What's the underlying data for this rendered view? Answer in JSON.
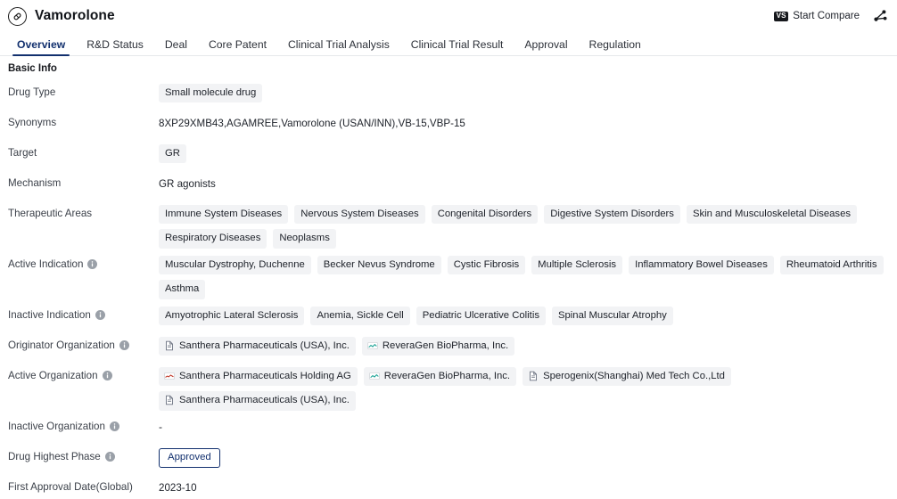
{
  "header": {
    "drug_name": "Vamorolone",
    "drug_icon": "capsule-icon",
    "compare_label": "Start Compare",
    "compare_badge": "VS",
    "share_icon": "share-nodes-icon"
  },
  "tabs": [
    {
      "label": "Overview",
      "active": true
    },
    {
      "label": "R&D Status",
      "active": false
    },
    {
      "label": "Deal",
      "active": false
    },
    {
      "label": "Core Patent",
      "active": false
    },
    {
      "label": "Clinical Trial Analysis",
      "active": false
    },
    {
      "label": "Clinical Trial Result",
      "active": false
    },
    {
      "label": "Approval",
      "active": false
    },
    {
      "label": "Regulation",
      "active": false
    }
  ],
  "section": {
    "title": "Basic Info"
  },
  "fields": {
    "drug_type": {
      "label": "Drug Type",
      "values": [
        "Small molecule drug"
      ]
    },
    "synonyms": {
      "label": "Synonyms",
      "text": "8XP29XMB43,AGAMREE,Vamorolone (USAN/INN),VB-15,VBP-15"
    },
    "target": {
      "label": "Target",
      "values": [
        "GR"
      ]
    },
    "mechanism": {
      "label": "Mechanism",
      "text": "GR agonists"
    },
    "therapeutic_areas": {
      "label": "Therapeutic Areas",
      "values": [
        "Immune System Diseases",
        "Nervous System Diseases",
        "Congenital Disorders",
        "Digestive System Disorders",
        "Skin and Musculoskeletal Diseases",
        "Respiratory Diseases",
        "Neoplasms"
      ]
    },
    "active_indication": {
      "label": "Active Indication",
      "has_info": true,
      "values": [
        "Muscular Dystrophy, Duchenne",
        "Becker Nevus Syndrome",
        "Cystic Fibrosis",
        "Multiple Sclerosis",
        "Inflammatory Bowel Diseases",
        "Rheumatoid Arthritis",
        "Asthma"
      ]
    },
    "inactive_indication": {
      "label": "Inactive Indication",
      "has_info": true,
      "values": [
        "Amyotrophic Lateral Sclerosis",
        "Anemia, Sickle Cell",
        "Pediatric Ulcerative Colitis",
        "Spinal Muscular Atrophy"
      ]
    },
    "originator_organization": {
      "label": "Originator Organization",
      "has_info": true,
      "values": [
        {
          "name": "Santhera Pharmaceuticals (USA), Inc.",
          "icon": "document-icon"
        },
        {
          "name": "ReveraGen BioPharma, Inc.",
          "icon": "company-logo-icon"
        }
      ]
    },
    "active_organization": {
      "label": "Active Organization",
      "has_info": true,
      "values": [
        {
          "name": "Santhera Pharmaceuticals Holding AG",
          "icon": "company-logo-icon"
        },
        {
          "name": "ReveraGen BioPharma, Inc.",
          "icon": "company-logo-icon"
        },
        {
          "name": "Sperogenix(Shanghai) Med Tech Co.,Ltd",
          "icon": "document-icon"
        },
        {
          "name": "Santhera Pharmaceuticals (USA), Inc.",
          "icon": "document-icon"
        }
      ]
    },
    "inactive_organization": {
      "label": "Inactive Organization",
      "has_info": true,
      "text": "-"
    },
    "drug_highest_phase": {
      "label": "Drug Highest Phase",
      "has_info": true,
      "badge": "Approved"
    },
    "first_approval_date": {
      "label": "First Approval Date(Global)",
      "text": "2023-10"
    }
  },
  "colors": {
    "accent": "#12306e",
    "chip_bg": "#f2f3f5",
    "label": "#3b4049",
    "text": "#1d2129"
  }
}
